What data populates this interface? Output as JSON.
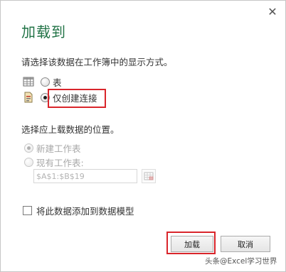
{
  "dialog": {
    "title": "加载到",
    "close_glyph": "✕",
    "prompt": "请选择该数据在工作簿中的显示方式。",
    "options": [
      {
        "label": "表",
        "icon": "table-icon",
        "selected": false
      },
      {
        "label": "仅创建连接",
        "icon": "connection-icon",
        "selected": true
      }
    ],
    "location_prompt": "选择应上载数据的位置。",
    "location_options": [
      {
        "label": "新建工作表",
        "selected": true,
        "enabled": false
      },
      {
        "label": "现有工作表:",
        "selected": false,
        "enabled": false
      }
    ],
    "location_value": "$A$1:$B$19",
    "data_model_checkbox": {
      "label": "将此数据添加到数据模型",
      "checked": false
    },
    "buttons": {
      "load": "加载",
      "cancel": "取消"
    },
    "highlight_color": "#d9252b",
    "title_color": "#217346"
  },
  "watermark": "头条@Excel学习世界"
}
